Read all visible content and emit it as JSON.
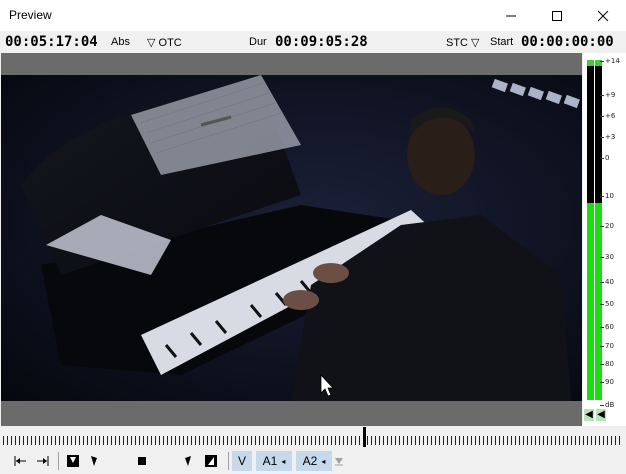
{
  "window": {
    "title": "Preview"
  },
  "timecode": {
    "current": "00:05:17:04",
    "mode_label": "Abs",
    "source_selector": "▽ OTC",
    "duration_label": "Dur",
    "duration": "00:09:05:28",
    "start_selector": "STC ▽",
    "start_label": "Start",
    "start": "00:00:00:00"
  },
  "audio_meter": {
    "scale": [
      "+14",
      "+9",
      "+6",
      "+3",
      "0",
      "10",
      "20",
      "30",
      "40",
      "50",
      "60",
      "70",
      "80",
      "90",
      "dB"
    ],
    "left_level_fraction": 0.59,
    "right_level_fraction": 0.59
  },
  "timeline": {
    "playhead_fraction": 0.58
  },
  "controls": {
    "tracks": [
      {
        "label": "V"
      },
      {
        "label": "A1",
        "arrow": "◂"
      },
      {
        "label": "A2",
        "arrow": "◂"
      }
    ]
  },
  "colors": {
    "meter_green": "#18e010",
    "track_bg": "#c6d8ec",
    "video_border": "#6b6b6b"
  }
}
